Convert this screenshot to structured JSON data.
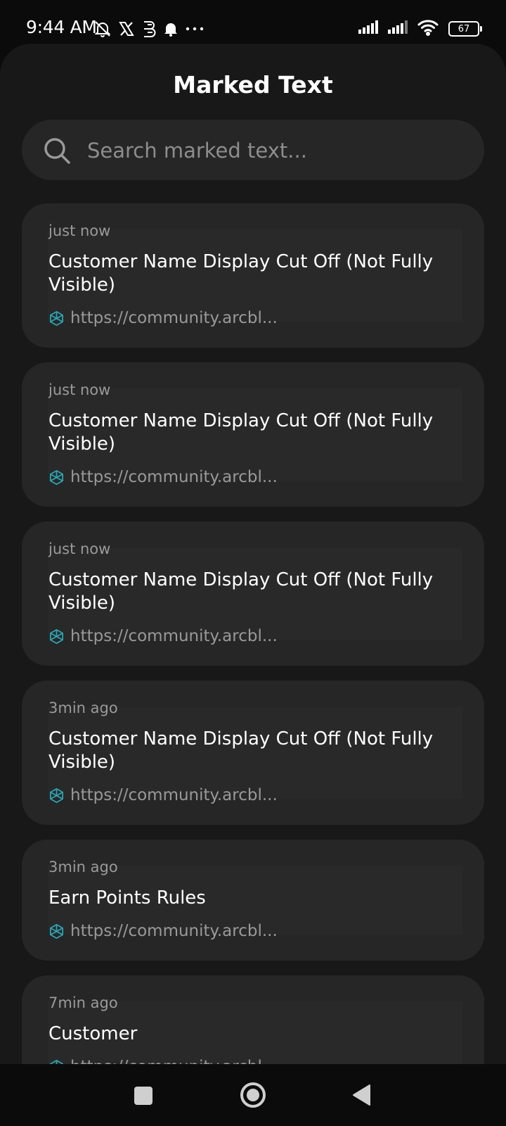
{
  "status_bar": {
    "time": "9:44 AM",
    "battery": "67",
    "icons": [
      "mute-bell-icon",
      "x-logo-icon",
      "b-app-icon",
      "bell-icon",
      "more-dots-icon",
      "signal-icon",
      "signal-icon",
      "wifi-icon",
      "battery-icon"
    ]
  },
  "header": {
    "title": "Marked Text"
  },
  "search": {
    "placeholder": "Search marked text..."
  },
  "cards": [
    {
      "time": "just now",
      "title": "Customer Name Display Cut Off (Not Fully Visible)",
      "url": "https://community.arcbl..."
    },
    {
      "time": "just now",
      "title": "Customer Name Display Cut Off (Not Fully Visible)",
      "url": "https://community.arcbl..."
    },
    {
      "time": "just now",
      "title": "Customer Name Display Cut Off (Not Fully Visible)",
      "url": "https://community.arcbl..."
    },
    {
      "time": "3min ago",
      "title": "Customer Name Display Cut Off (Not Fully Visible)",
      "url": "https://community.arcbl..."
    },
    {
      "time": "3min ago",
      "title": "Earn Points Rules",
      "url": "https://community.arcbl..."
    },
    {
      "time": "7min ago",
      "title": "Customer",
      "url": "https://community.arcbl..."
    }
  ],
  "colors": {
    "background": "#0b0b0b",
    "panel": "#181818",
    "card": "#262626",
    "link_icon": "#2aa7b5"
  }
}
